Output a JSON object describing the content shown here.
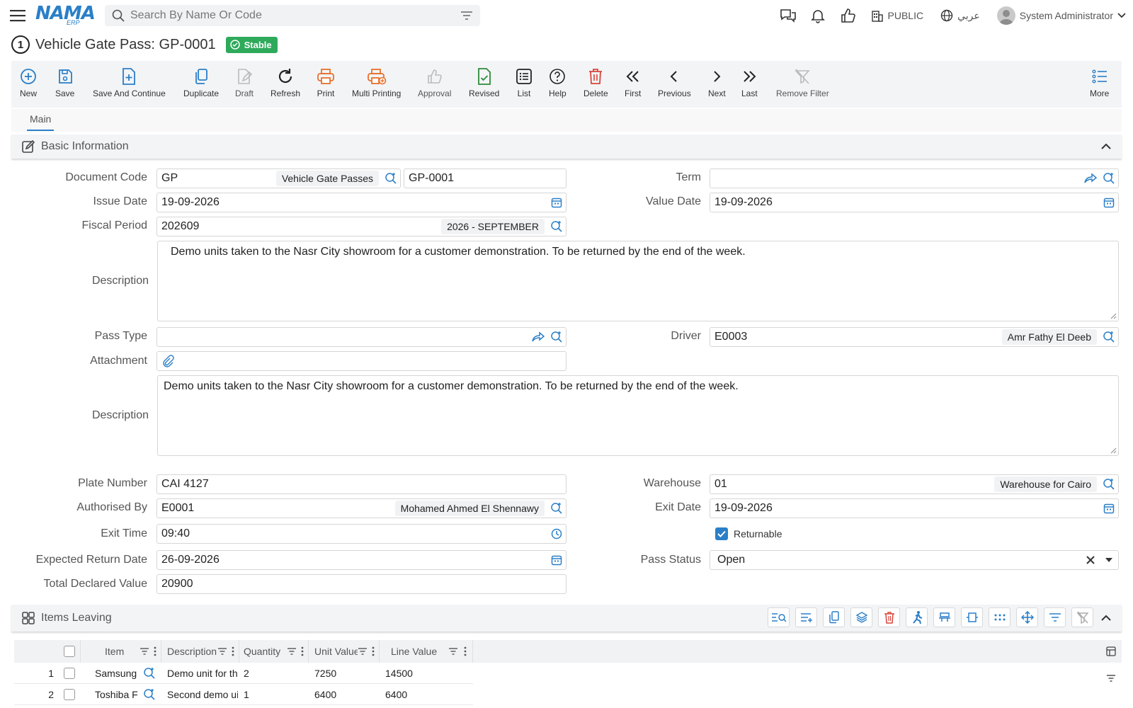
{
  "topbar": {
    "logo_main": "NAMA",
    "logo_sub": "ERP",
    "search_placeholder": "Search By Name Or Code",
    "branch": "PUBLIC",
    "language": "عربي",
    "user": "System Administrator"
  },
  "header": {
    "step": "1",
    "title": "Vehicle Gate Pass: GP-0001",
    "status": "Stable"
  },
  "toolbar": {
    "new": "New",
    "save": "Save",
    "save_continue": "Save And Continue",
    "duplicate": "Duplicate",
    "draft": "Draft",
    "refresh": "Refresh",
    "print": "Print",
    "multi_printing": "Multi Printing",
    "approval": "Approval",
    "revised": "Revised",
    "list": "List",
    "help": "Help",
    "delete": "Delete",
    "first": "First",
    "previous": "Previous",
    "next": "Next",
    "last": "Last",
    "remove_filter": "Remove Filter",
    "more": "More"
  },
  "tabs": {
    "main": "Main"
  },
  "basic": {
    "section_title": "Basic Information",
    "document_code_label": "Document Code",
    "document_code": "GP",
    "document_type": "Vehicle Gate Passes",
    "document_number": "GP-0001",
    "term_label": "Term",
    "term": "",
    "issue_date_label": "Issue Date",
    "issue_date": "19-09-2026",
    "value_date_label": "Value Date",
    "value_date": "19-09-2026",
    "fiscal_period_label": "Fiscal Period",
    "fiscal_period": "202609",
    "fiscal_period_name": "2026 - SEPTEMBER",
    "description_label": "Description",
    "description": "Demo units taken to the Nasr City showroom for a customer demonstration. To be returned by the end of the week.",
    "pass_type_label": "Pass Type",
    "pass_type": "",
    "driver_label": "Driver",
    "driver_code": "E0003",
    "driver_name": "Amr Fathy El Deeb",
    "attachment_label": "Attachment",
    "description2_label": "Description",
    "description2": "Demo units taken to the Nasr City showroom for a customer demonstration. To be returned by the end of the week.",
    "plate_number_label": "Plate Number",
    "plate_number": "CAI 4127",
    "warehouse_label": "Warehouse",
    "warehouse_code": "01",
    "warehouse_name": "Warehouse for Cairo",
    "authorised_by_label": "Authorised By",
    "authorised_by_code": "E0001",
    "authorised_by_name": "Mohamed Ahmed El Shennawy",
    "exit_date_label": "Exit Date",
    "exit_date": "19-09-2026",
    "exit_time_label": "Exit Time",
    "exit_time": "09:40",
    "returnable_label": "Returnable",
    "expected_return_label": "Expected Return Date",
    "expected_return": "26-09-2026",
    "pass_status_label": "Pass Status",
    "pass_status": "Open",
    "total_declared_label": "Total Declared Value",
    "total_declared": "20900"
  },
  "items": {
    "section_title": "Items Leaving",
    "columns": [
      "Item",
      "Description",
      "Quantity",
      "Unit Value",
      "Line Value"
    ],
    "rows": [
      {
        "num": "1",
        "item": "Samsung",
        "description": "Demo unit for th",
        "quantity": "2",
        "unit_value": "7250",
        "line_value": "14500"
      },
      {
        "num": "2",
        "item": "Toshiba F",
        "description": "Second demo ui",
        "quantity": "1",
        "unit_value": "6400",
        "line_value": "6400"
      }
    ]
  },
  "colors": {
    "accent": "#2a7fc8",
    "stable": "#2eaa5a",
    "print": "#e8712b",
    "delete": "#d9463b",
    "revised": "#2e8b3a"
  }
}
